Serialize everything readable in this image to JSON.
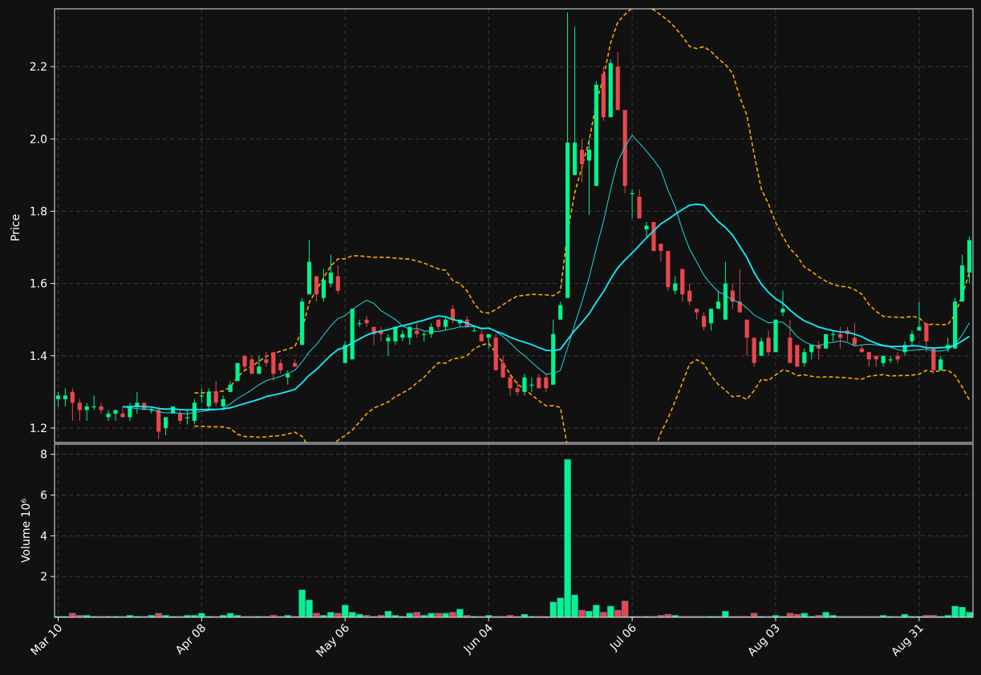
{
  "chart_data": {
    "type": "candlestick",
    "colors": {
      "background": "#111111",
      "up": "#00f58c",
      "down": "#e8474e",
      "ma_short": "#22d9d9",
      "ma_long": "#0ff1ff",
      "band": "#ffa500",
      "grid": "#3a3a3a"
    },
    "x_tick_labels": [
      "Mar 10",
      "Apr 08",
      "May 06",
      "Jun 04",
      "Jul 06",
      "Aug 03",
      "Aug 31"
    ],
    "price_panel": {
      "ylabel": "Price",
      "ylim": [
        1.16,
        2.36
      ],
      "yticks": [
        "1.2",
        "1.4",
        "1.6",
        "1.8",
        "2.0",
        "2.2"
      ]
    },
    "volume_panel": {
      "ylabel": "Volume  10⁶",
      "ylim": [
        0,
        8.5
      ],
      "yticks": [
        "2",
        "4",
        "6",
        "8"
      ]
    },
    "grid": true,
    "candles": [
      [
        1.28,
        1.3,
        1.26,
        1.29,
        0.05
      ],
      [
        1.28,
        1.31,
        1.26,
        1.29,
        0.05
      ],
      [
        1.3,
        1.31,
        1.22,
        1.27,
        0.2
      ],
      [
        1.27,
        1.28,
        1.22,
        1.25,
        0.1
      ],
      [
        1.25,
        1.27,
        1.22,
        1.26,
        0.1
      ],
      [
        1.26,
        1.29,
        1.25,
        1.26,
        0.05
      ],
      [
        1.26,
        1.27,
        1.24,
        1.25,
        0.05
      ],
      [
        1.23,
        1.25,
        1.22,
        1.24,
        0.05
      ],
      [
        1.24,
        1.25,
        1.22,
        1.25,
        0.05
      ],
      [
        1.24,
        1.26,
        1.23,
        1.23,
        0.05
      ],
      [
        1.23,
        1.27,
        1.22,
        1.26,
        0.1
      ],
      [
        1.26,
        1.3,
        1.24,
        1.27,
        0.05
      ],
      [
        1.27,
        1.27,
        1.25,
        1.25,
        0.05
      ],
      [
        1.25,
        1.26,
        1.24,
        1.25,
        0.1
      ],
      [
        1.25,
        1.26,
        1.17,
        1.19,
        0.2
      ],
      [
        1.2,
        1.23,
        1.18,
        1.23,
        0.1
      ],
      [
        1.24,
        1.26,
        1.24,
        1.26,
        0.05
      ],
      [
        1.24,
        1.25,
        1.21,
        1.22,
        0.05
      ],
      [
        1.23,
        1.25,
        1.21,
        1.23,
        0.1
      ],
      [
        1.22,
        1.28,
        1.21,
        1.27,
        0.1
      ],
      [
        1.29,
        1.31,
        1.27,
        1.29,
        0.2
      ],
      [
        1.26,
        1.31,
        1.25,
        1.3,
        0.05
      ],
      [
        1.3,
        1.33,
        1.26,
        1.27,
        0.05
      ],
      [
        1.26,
        1.29,
        1.25,
        1.28,
        0.1
      ],
      [
        1.3,
        1.33,
        1.3,
        1.32,
        0.2
      ],
      [
        1.33,
        1.38,
        1.33,
        1.38,
        0.1
      ],
      [
        1.4,
        1.4,
        1.36,
        1.37,
        0.05
      ],
      [
        1.39,
        1.4,
        1.35,
        1.35,
        0.05
      ],
      [
        1.35,
        1.4,
        1.35,
        1.37,
        0.05
      ],
      [
        1.39,
        1.41,
        1.37,
        1.38,
        0.05
      ],
      [
        1.41,
        1.41,
        1.33,
        1.35,
        0.1
      ],
      [
        1.38,
        1.39,
        1.35,
        1.36,
        0.05
      ],
      [
        1.34,
        1.36,
        1.32,
        1.35,
        0.1
      ],
      [
        1.38,
        1.39,
        1.37,
        1.37,
        0.05
      ],
      [
        1.43,
        1.56,
        1.43,
        1.55,
        1.35
      ],
      [
        1.57,
        1.72,
        1.57,
        1.66,
        0.85
      ],
      [
        1.62,
        1.62,
        1.55,
        1.57,
        0.2
      ],
      [
        1.56,
        1.64,
        1.55,
        1.61,
        0.1
      ],
      [
        1.6,
        1.68,
        1.59,
        1.63,
        0.25
      ],
      [
        1.62,
        1.65,
        1.57,
        1.58,
        0.2
      ],
      [
        1.38,
        1.44,
        1.38,
        1.43,
        0.6
      ],
      [
        1.39,
        1.53,
        1.39,
        1.53,
        0.25
      ],
      [
        1.49,
        1.5,
        1.48,
        1.49,
        0.15
      ],
      [
        1.5,
        1.51,
        1.48,
        1.49,
        0.1
      ],
      [
        1.48,
        1.48,
        1.43,
        1.46,
        0.05
      ],
      [
        1.47,
        1.48,
        1.44,
        1.46,
        0.1
      ],
      [
        1.44,
        1.46,
        1.4,
        1.45,
        0.3
      ],
      [
        1.44,
        1.48,
        1.43,
        1.48,
        0.1
      ],
      [
        1.45,
        1.47,
        1.44,
        1.46,
        0.05
      ],
      [
        1.45,
        1.48,
        1.43,
        1.48,
        0.2
      ],
      [
        1.47,
        1.49,
        1.45,
        1.46,
        0.25
      ],
      [
        1.46,
        1.47,
        1.44,
        1.46,
        0.1
      ],
      [
        1.46,
        1.49,
        1.45,
        1.48,
        0.2
      ],
      [
        1.5,
        1.5,
        1.47,
        1.48,
        0.2
      ],
      [
        1.48,
        1.51,
        1.47,
        1.5,
        0.2
      ],
      [
        1.53,
        1.54,
        1.49,
        1.5,
        0.25
      ],
      [
        1.49,
        1.5,
        1.48,
        1.5,
        0.4
      ],
      [
        1.5,
        1.51,
        1.49,
        1.48,
        0.1
      ],
      [
        1.47,
        1.48,
        1.47,
        1.47,
        0.05
      ],
      [
        1.46,
        1.47,
        1.44,
        1.44,
        0.05
      ],
      [
        1.45,
        1.46,
        1.42,
        1.46,
        0.1
      ],
      [
        1.45,
        1.46,
        1.36,
        1.36,
        0.05
      ],
      [
        1.38,
        1.4,
        1.34,
        1.34,
        0.05
      ],
      [
        1.34,
        1.35,
        1.29,
        1.31,
        0.1
      ],
      [
        1.31,
        1.33,
        1.29,
        1.3,
        0.05
      ],
      [
        1.3,
        1.35,
        1.29,
        1.34,
        0.15
      ],
      [
        1.32,
        1.34,
        1.3,
        1.32,
        0.05
      ],
      [
        1.34,
        1.35,
        1.31,
        1.31,
        0.05
      ],
      [
        1.34,
        1.35,
        1.3,
        1.31,
        0.05
      ],
      [
        1.32,
        1.5,
        1.32,
        1.46,
        0.75
      ],
      [
        1.5,
        1.55,
        1.5,
        1.54,
        0.95
      ],
      [
        1.56,
        2.35,
        1.56,
        1.99,
        7.75
      ],
      [
        1.9,
        2.31,
        1.9,
        1.99,
        1.1
      ],
      [
        1.97,
        2.0,
        1.88,
        1.93,
        0.35
      ],
      [
        1.94,
        2.0,
        1.79,
        1.97,
        0.3
      ],
      [
        1.87,
        2.16,
        1.87,
        2.15,
        0.6
      ],
      [
        2.18,
        2.2,
        2.05,
        2.06,
        0.25
      ],
      [
        2.06,
        2.22,
        2.06,
        2.21,
        0.55
      ],
      [
        2.2,
        2.24,
        2.08,
        2.08,
        0.35
      ],
      [
        2.08,
        2.08,
        1.85,
        1.87,
        0.8
      ],
      [
        1.85,
        1.86,
        1.78,
        1.85,
        0.05
      ],
      [
        1.84,
        1.86,
        1.78,
        1.78,
        0.05
      ],
      [
        1.75,
        1.77,
        1.73,
        1.76,
        0.05
      ],
      [
        1.77,
        1.77,
        1.69,
        1.69,
        0.05
      ],
      [
        1.71,
        1.71,
        1.66,
        1.69,
        0.1
      ],
      [
        1.69,
        1.69,
        1.58,
        1.59,
        0.15
      ],
      [
        1.58,
        1.62,
        1.57,
        1.6,
        0.1
      ],
      [
        1.64,
        1.64,
        1.55,
        1.57,
        0.05
      ],
      [
        1.58,
        1.6,
        1.54,
        1.55,
        0.05
      ],
      [
        1.53,
        1.53,
        1.5,
        1.52,
        0.05
      ],
      [
        1.51,
        1.52,
        1.47,
        1.48,
        0.05
      ],
      [
        1.49,
        1.53,
        1.47,
        1.53,
        0.05
      ],
      [
        1.53,
        1.58,
        1.53,
        1.55,
        0.05
      ],
      [
        1.5,
        1.66,
        1.5,
        1.6,
        0.3
      ],
      [
        1.58,
        1.6,
        1.53,
        1.55,
        0.05
      ],
      [
        1.55,
        1.64,
        1.52,
        1.52,
        0.05
      ],
      [
        1.5,
        1.5,
        1.4,
        1.45,
        0.05
      ],
      [
        1.45,
        1.45,
        1.37,
        1.38,
        0.2
      ],
      [
        1.4,
        1.45,
        1.4,
        1.44,
        0.05
      ],
      [
        1.45,
        1.47,
        1.4,
        1.41,
        0.05
      ],
      [
        1.41,
        1.5,
        1.41,
        1.5,
        0.1
      ],
      [
        1.52,
        1.58,
        1.51,
        1.53,
        0.05
      ],
      [
        1.45,
        1.5,
        1.38,
        1.38,
        0.2
      ],
      [
        1.43,
        1.43,
        1.37,
        1.37,
        0.15
      ],
      [
        1.38,
        1.42,
        1.37,
        1.41,
        0.2
      ],
      [
        1.41,
        1.43,
        1.39,
        1.43,
        0.05
      ],
      [
        1.43,
        1.44,
        1.39,
        1.42,
        0.1
      ],
      [
        1.42,
        1.46,
        1.42,
        1.46,
        0.25
      ],
      [
        1.46,
        1.47,
        1.44,
        1.46,
        0.1
      ],
      [
        1.46,
        1.48,
        1.42,
        1.45,
        0.05
      ],
      [
        1.47,
        1.48,
        1.44,
        1.46,
        0.05
      ],
      [
        1.45,
        1.49,
        1.43,
        1.43,
        0.05
      ],
      [
        1.42,
        1.43,
        1.41,
        1.41,
        0.05
      ],
      [
        1.41,
        1.41,
        1.37,
        1.39,
        0.05
      ],
      [
        1.4,
        1.4,
        1.37,
        1.39,
        0.05
      ],
      [
        1.38,
        1.4,
        1.37,
        1.4,
        0.1
      ],
      [
        1.39,
        1.4,
        1.38,
        1.39,
        0.05
      ],
      [
        1.4,
        1.41,
        1.38,
        1.39,
        0.05
      ],
      [
        1.41,
        1.44,
        1.4,
        1.43,
        0.15
      ],
      [
        1.44,
        1.47,
        1.43,
        1.46,
        0.05
      ],
      [
        1.47,
        1.55,
        1.47,
        1.48,
        0.05
      ],
      [
        1.49,
        1.49,
        1.41,
        1.44,
        0.1
      ],
      [
        1.42,
        1.42,
        1.35,
        1.36,
        0.1
      ],
      [
        1.36,
        1.4,
        1.36,
        1.39,
        0.05
      ],
      [
        1.42,
        1.45,
        1.41,
        1.43,
        0.1
      ],
      [
        1.42,
        1.56,
        1.42,
        1.55,
        0.55
      ],
      [
        1.55,
        1.68,
        1.55,
        1.65,
        0.5
      ],
      [
        1.63,
        1.73,
        1.6,
        1.72,
        0.25
      ]
    ]
  }
}
